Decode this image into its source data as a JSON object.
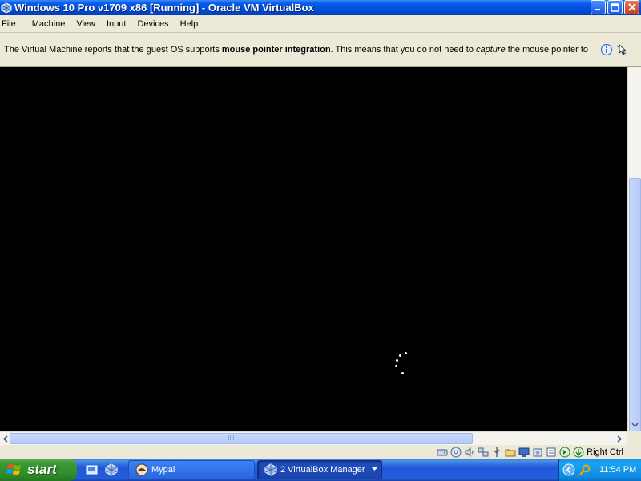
{
  "window": {
    "title": "Windows 10 Pro v1709 x86 [Running] - Oracle VM VirtualBox",
    "app_icon": "virtualbox-icon",
    "controls": [
      "minimize-icon",
      "maximize-icon",
      "close-icon"
    ]
  },
  "menu": {
    "items": [
      "File",
      "Machine",
      "View",
      "Input",
      "Devices",
      "Help"
    ]
  },
  "notice": {
    "text_1": "The Virtual Machine reports that the guest OS supports ",
    "bold": "mouse pointer integration",
    "text_2": ". This means that you do not need to ",
    "italic": "capture",
    "text_3": " the mouse pointer to",
    "icons": [
      "info-icon",
      "mouse-integration-icon"
    ]
  },
  "vm_screen": {
    "background": "#000000",
    "indicator": "loading-spinner"
  },
  "status_bar": {
    "icons": [
      "hard-disk-icon",
      "optical-drive-icon",
      "audio-icon",
      "network-icon",
      "usb-icon",
      "shared-folders-icon",
      "display-icon",
      "video-capture-icon",
      "vt-x-icon",
      "mouse-integration-icon",
      "keyboard-icon"
    ],
    "host_key": "Right Ctrl"
  },
  "taskbar": {
    "start_label": "start",
    "quicklaunch": [
      "show-desktop-icon",
      "virtualbox-icon"
    ],
    "tasks": [
      {
        "label": "Mypal",
        "icon": "mypal-icon",
        "active": false
      },
      {
        "label": "2 VirtualBox Manager",
        "icon": "virtualbox-icon",
        "active": true
      }
    ],
    "tray": {
      "icons": [
        "chevron-left-icon",
        "search-icon"
      ],
      "clock": "11:54 PM"
    }
  },
  "colors": {
    "titlebar": "#0050e0",
    "taskbar": "#245edb",
    "start_button": "#3c9a34",
    "tray": "#0f8ce3",
    "chrome": "#ece9d8"
  }
}
